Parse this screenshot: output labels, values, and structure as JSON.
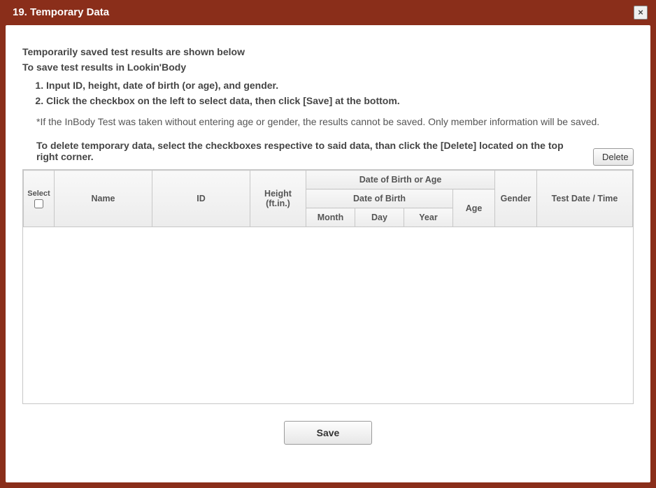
{
  "title": "19. Temporary Data",
  "close_label": "×",
  "intro": {
    "line1": "Temporarily saved test results are shown below",
    "line2": "To save test results in Lookin'Body",
    "steps": [
      "Input ID, height, date of birth (or age), and gender.",
      "Click the checkbox on the left to select data, then click [Save] at the bottom."
    ],
    "note": "*If the InBody Test was taken without entering age or gender, the results cannot be saved. Only member information will be saved.",
    "delete_text": "To delete temporary data, select the checkboxes respective to said data, than click the [Delete] located on the top right corner."
  },
  "buttons": {
    "delete": "Delete",
    "save": "Save"
  },
  "table": {
    "headers": {
      "select": "Select",
      "name": "Name",
      "id": "ID",
      "height": "Height (ft.in.)",
      "dob_age": "Date of Birth or Age",
      "dob": "Date of Birth",
      "month": "Month",
      "day": "Day",
      "year": "Year",
      "age": "Age",
      "gender": "Gender",
      "test_dt": "Test Date / Time"
    },
    "rows": []
  }
}
